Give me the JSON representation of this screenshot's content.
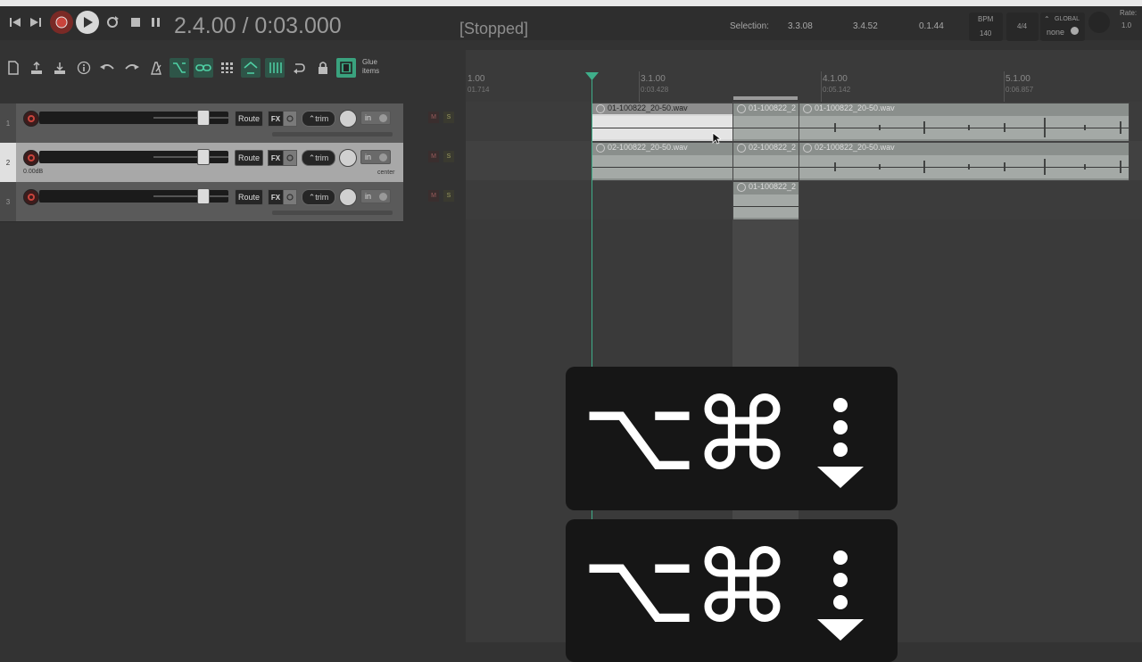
{
  "transport": {
    "time": "2.4.00 / 0:03.000",
    "status": "[Stopped]",
    "selection_label": "Selection:",
    "selection_start": "3.3.08",
    "selection_end": "3.4.52",
    "selection_length": "0.1.44",
    "bpm_label": "BPM",
    "bpm": "140",
    "time_sig": "4/4",
    "global_label": "GLOBAL",
    "global_value": "none",
    "rate_label": "Rate:",
    "rate_value": "1.0"
  },
  "toolbar": {
    "glue_line1": "Glue",
    "glue_line2": "items"
  },
  "ruler": [
    {
      "bar": "1.00",
      "time": "01.714"
    },
    {
      "bar": "3.1.00",
      "time": "0:03.428"
    },
    {
      "bar": "4.1.00",
      "time": "0:05.142"
    },
    {
      "bar": "5.1.00",
      "time": "0:06.857"
    }
  ],
  "tracks": [
    {
      "number": "1",
      "route": "Route",
      "fx": "FX",
      "trim": "trim",
      "input": "in",
      "mute": "M",
      "solo": "S"
    },
    {
      "number": "2",
      "route": "Route",
      "fx": "FX",
      "trim": "trim",
      "input": "in",
      "mute": "M",
      "solo": "S",
      "volume": "0.00dB",
      "pan": "center"
    },
    {
      "number": "3",
      "route": "Route",
      "fx": "FX",
      "trim": "trim",
      "input": "in",
      "mute": "M",
      "solo": "S"
    }
  ],
  "items": {
    "t1_a": "01-100822_20-50.wav",
    "t1_b": "01-100822_2",
    "t1_c": "01-100822_20-50.wav",
    "t2_a": "02-100822_20-50.wav",
    "t2_b": "02-100822_2",
    "t2_c": "02-100822_20-50.wav",
    "t3_a": "01-100822_2"
  },
  "shortcut": {
    "option_symbol": "⌥",
    "command_symbol": "⌘",
    "key_icon": "drag-down-icon"
  },
  "colors": {
    "accent_green": "#3fae8a",
    "record_red": "#c9443c",
    "background": "#333333"
  }
}
